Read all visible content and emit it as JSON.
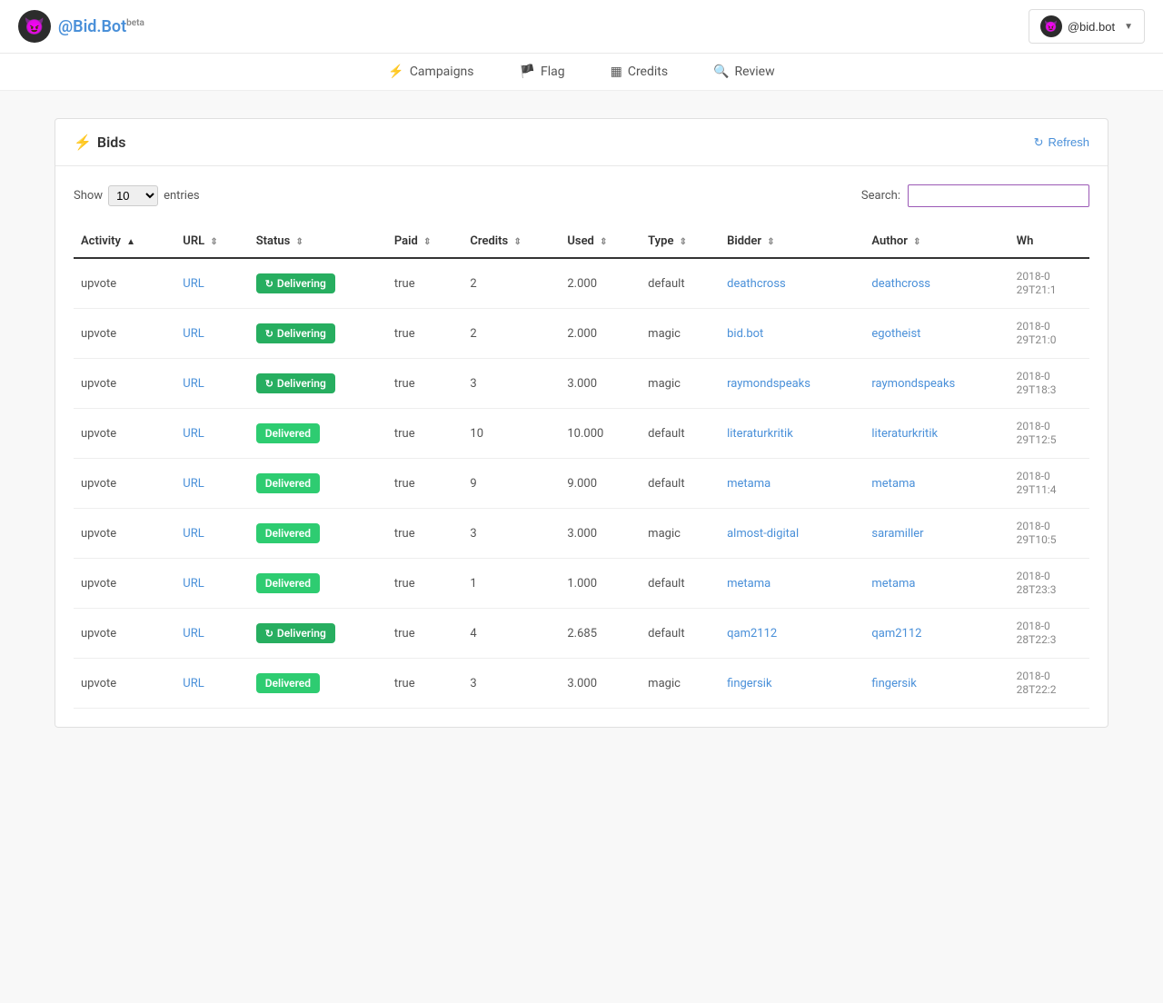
{
  "header": {
    "logo_text": "@Bid.Bot",
    "logo_beta": "beta",
    "logo_emoji": "😈",
    "user_name": "@bid.bot",
    "user_emoji": "😈",
    "dropdown_arrow": "▼"
  },
  "nav": {
    "items": [
      {
        "id": "campaigns",
        "icon": "⚡",
        "label": "Campaigns"
      },
      {
        "id": "flag",
        "icon": "🏴",
        "label": "Flag"
      },
      {
        "id": "credits",
        "icon": "▦",
        "label": "Credits"
      },
      {
        "id": "review",
        "icon": "🔍",
        "label": "Review"
      }
    ]
  },
  "bids_section": {
    "title": "Bids",
    "title_icon": "⚡",
    "refresh_label": "Refresh",
    "refresh_icon": "↻"
  },
  "table_controls": {
    "show_label": "Show",
    "entries_value": "10",
    "entries_label": "entries",
    "search_label": "Search:",
    "search_placeholder": ""
  },
  "table": {
    "columns": [
      {
        "id": "activity",
        "label": "Activity",
        "sort": "asc"
      },
      {
        "id": "url",
        "label": "URL",
        "sort": "both"
      },
      {
        "id": "status",
        "label": "Status",
        "sort": "both"
      },
      {
        "id": "paid",
        "label": "Paid",
        "sort": "both"
      },
      {
        "id": "credits",
        "label": "Credits",
        "sort": "both"
      },
      {
        "id": "used",
        "label": "Used",
        "sort": "both"
      },
      {
        "id": "type",
        "label": "Type",
        "sort": "both"
      },
      {
        "id": "bidder",
        "label": "Bidder",
        "sort": "both"
      },
      {
        "id": "author",
        "label": "Author",
        "sort": "both"
      },
      {
        "id": "when",
        "label": "Wh"
      }
    ],
    "rows": [
      {
        "activity": "upvote",
        "url": "URL",
        "status": "Delivering",
        "status_type": "delivering",
        "paid": "true",
        "credits": "2",
        "used": "2.000",
        "type": "default",
        "bidder": "deathcross",
        "author": "deathcross",
        "when": "2018-0\n29T21:1"
      },
      {
        "activity": "upvote",
        "url": "URL",
        "status": "Delivering",
        "status_type": "delivering",
        "paid": "true",
        "credits": "2",
        "used": "2.000",
        "type": "magic",
        "bidder": "bid.bot",
        "author": "egotheist",
        "when": "2018-0\n29T21:0"
      },
      {
        "activity": "upvote",
        "url": "URL",
        "status": "Delivering",
        "status_type": "delivering",
        "paid": "true",
        "credits": "3",
        "used": "3.000",
        "type": "magic",
        "bidder": "raymondspeaks",
        "author": "raymondspeaks",
        "when": "2018-0\n29T18:3"
      },
      {
        "activity": "upvote",
        "url": "URL",
        "status": "Delivered",
        "status_type": "delivered",
        "paid": "true",
        "credits": "10",
        "used": "10.000",
        "type": "default",
        "bidder": "literaturkritik",
        "author": "literaturkritik",
        "when": "2018-0\n29T12:5"
      },
      {
        "activity": "upvote",
        "url": "URL",
        "status": "Delivered",
        "status_type": "delivered",
        "paid": "true",
        "credits": "9",
        "used": "9.000",
        "type": "default",
        "bidder": "metama",
        "author": "metama",
        "when": "2018-0\n29T11:4"
      },
      {
        "activity": "upvote",
        "url": "URL",
        "status": "Delivered",
        "status_type": "delivered",
        "paid": "true",
        "credits": "3",
        "used": "3.000",
        "type": "magic",
        "bidder": "almost-digital",
        "author": "saramiller",
        "when": "2018-0\n29T10:5"
      },
      {
        "activity": "upvote",
        "url": "URL",
        "status": "Delivered",
        "status_type": "delivered",
        "paid": "true",
        "credits": "1",
        "used": "1.000",
        "type": "default",
        "bidder": "metama",
        "author": "metama",
        "when": "2018-0\n28T23:3"
      },
      {
        "activity": "upvote",
        "url": "URL",
        "status": "Delivering",
        "status_type": "delivering",
        "paid": "true",
        "credits": "4",
        "used": "2.685",
        "type": "default",
        "bidder": "qam2112",
        "author": "qam2112",
        "when": "2018-0\n28T22:3"
      },
      {
        "activity": "upvote",
        "url": "URL",
        "status": "Delivered",
        "status_type": "delivered",
        "paid": "true",
        "credits": "3",
        "used": "3.000",
        "type": "magic",
        "bidder": "fingersik",
        "author": "fingersik",
        "when": "2018-0\n28T22:2"
      }
    ]
  }
}
